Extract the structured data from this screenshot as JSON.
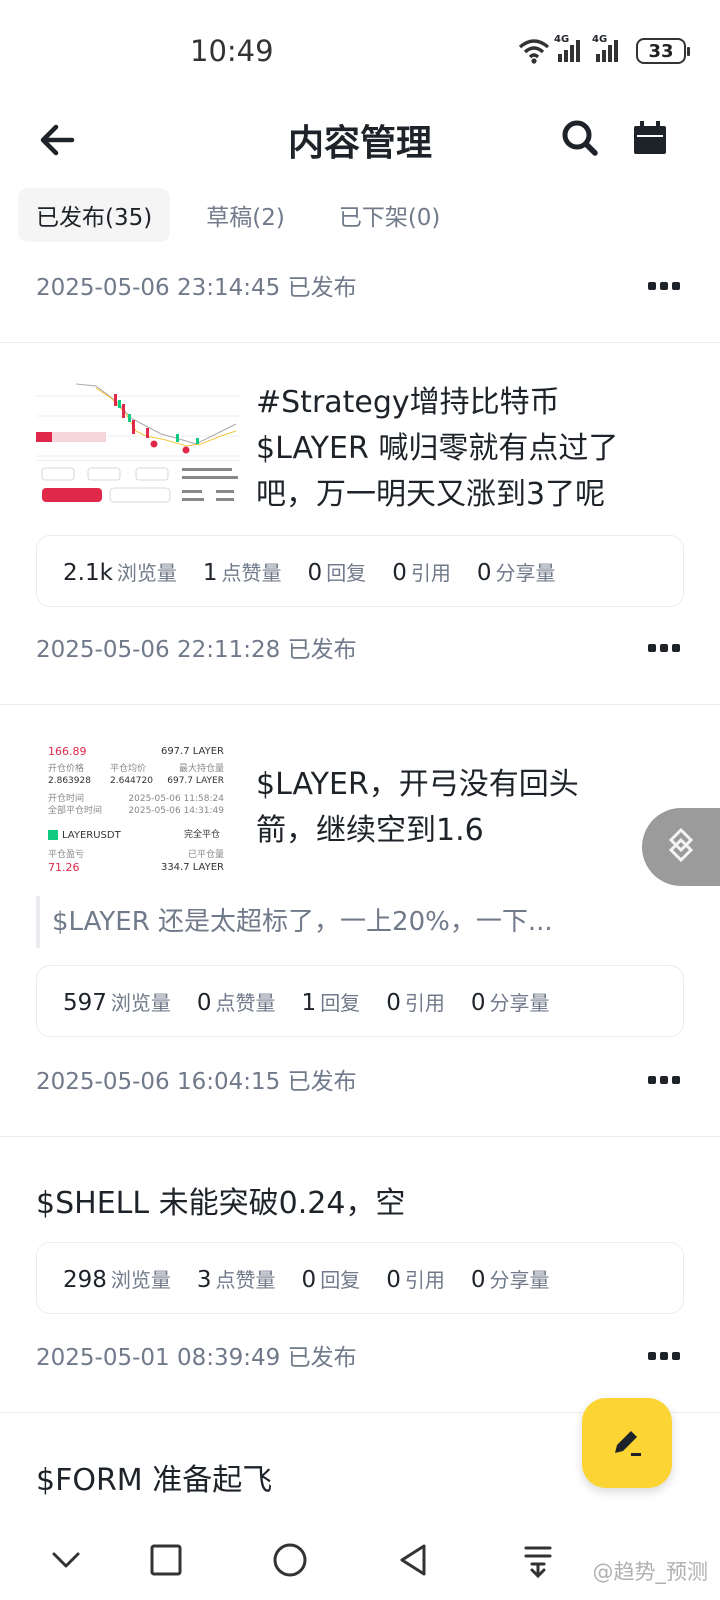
{
  "status_bar": {
    "time": "10:49",
    "battery": "33",
    "network_1": "4G",
    "network_2": "4G"
  },
  "header": {
    "title": "内容管理"
  },
  "tabs": [
    {
      "label": "已发布(35)"
    },
    {
      "label": "草稿(2)"
    },
    {
      "label": "已下架(0)"
    }
  ],
  "top_timestamp": "2025-05-06 23:14:45 已发布",
  "posts": [
    {
      "text": "#Strategy增持比特币 $LAYER 喊归零就有点过了吧，万一明天又涨到3了呢",
      "views": "2.1k",
      "likes": "1",
      "replies": "0",
      "quotes": "0",
      "shares": "0",
      "timestamp": "2025-05-06 22:11:28 已发布"
    },
    {
      "text": "$LAYER，开弓没有回头箭，继续空到1.6",
      "quote": "$LAYER 还是太超标了，一上20%，一下...",
      "views": "597",
      "likes": "0",
      "replies": "1",
      "quotes": "0",
      "shares": "0",
      "timestamp": "2025-05-06 16:04:15 已发布",
      "thumb": {
        "top_left": "166.89",
        "top_right": "697.7 LAYER",
        "row1_labels": [
          "开仓价格",
          "平仓均价",
          "最大持仓量"
        ],
        "row1_values": [
          "2.863928",
          "2.644720",
          "697.7 LAYER"
        ],
        "open_time_label": "开仓时间",
        "open_time": "2025-05-06 11:58:24",
        "close_time_label": "全部平仓时间",
        "close_time": "2025-05-06 14:31:49",
        "symbol": "LAYERUSDT",
        "status": "完全平仓",
        "pnl_label": "平仓盈亏",
        "pnl": "71.26",
        "closed_label": "已平仓量",
        "closed": "334.7 LAYER"
      }
    },
    {
      "text": "$SHELL 未能突破0.24，空",
      "views": "298",
      "likes": "3",
      "replies": "0",
      "quotes": "0",
      "shares": "0",
      "timestamp": "2025-05-01 08:39:49 已发布"
    },
    {
      "text": "$FORM 准备起飞"
    }
  ],
  "stat_labels": {
    "views": "浏览量",
    "likes": "点赞量",
    "replies": "回复",
    "quotes": "引用",
    "shares": "分享量"
  },
  "watermark": "@趋势_预测"
}
